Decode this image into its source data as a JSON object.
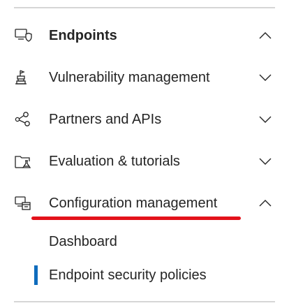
{
  "nav": {
    "items": [
      {
        "label": "Endpoints",
        "icon": "endpoint-shield-icon",
        "state": "expanded"
      },
      {
        "label": "Vulnerability management",
        "icon": "vulnerability-icon",
        "state": "collapsed"
      },
      {
        "label": "Partners and APIs",
        "icon": "partners-nodes-icon",
        "state": "collapsed"
      },
      {
        "label": "Evaluation & tutorials",
        "icon": "evaluation-flask-icon",
        "state": "collapsed"
      },
      {
        "label": "Configuration management",
        "icon": "configuration-icon",
        "state": "expanded"
      }
    ],
    "sub_items": [
      {
        "label": "Dashboard"
      },
      {
        "label": "Endpoint security policies",
        "active": true
      }
    ]
  },
  "colors": {
    "active_indicator": "#0f6cbd",
    "highlight_underline": "#e3121b",
    "divider": "#d6d6d6",
    "text": "#242424"
  }
}
